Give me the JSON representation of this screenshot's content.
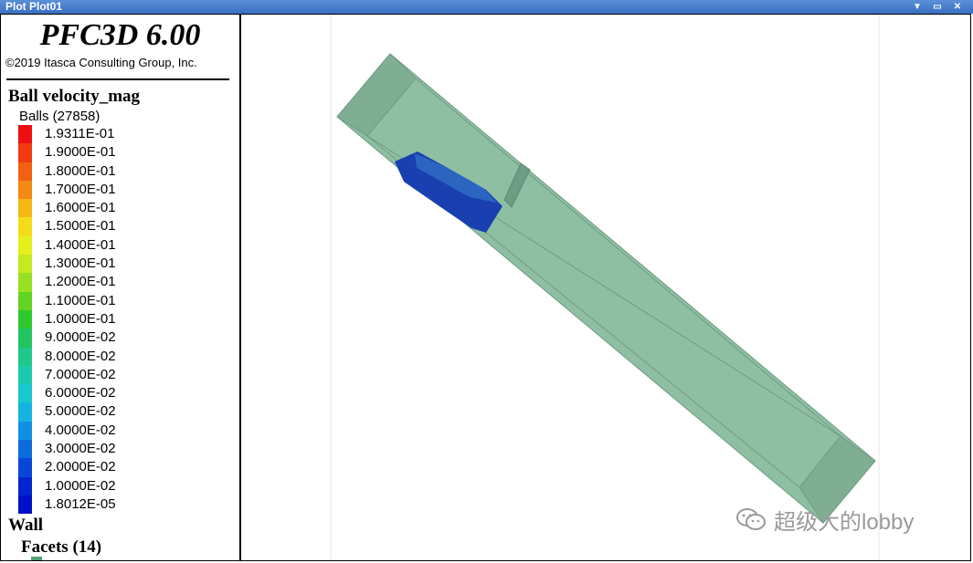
{
  "window": {
    "title": "Plot Plot01",
    "controls": {
      "dropdown": "▼",
      "restore": "▭",
      "close": "✕"
    }
  },
  "legend": {
    "brand": "PFC3D 6.00",
    "copyright": "©2019 Itasca Consulting Group, Inc.",
    "ball_section": {
      "title": "Ball velocity_mag",
      "subtitle": "Balls (27858)",
      "entries": [
        {
          "value": "1.9311E-01",
          "color": "#ee1010"
        },
        {
          "value": "1.9000E-01",
          "color": "#f03a10"
        },
        {
          "value": "1.8000E-01",
          "color": "#f26012"
        },
        {
          "value": "1.7000E-01",
          "color": "#f28a12"
        },
        {
          "value": "1.6000E-01",
          "color": "#f5b814"
        },
        {
          "value": "1.5000E-01",
          "color": "#f5dc18"
        },
        {
          "value": "1.4000E-01",
          "color": "#e4f01c"
        },
        {
          "value": "1.3000E-01",
          "color": "#c4ea20"
        },
        {
          "value": "1.2000E-01",
          "color": "#98e022"
        },
        {
          "value": "1.1000E-01",
          "color": "#62d424"
        },
        {
          "value": "1.0000E-01",
          "color": "#2ec82e"
        },
        {
          "value": "9.0000E-02",
          "color": "#22c460"
        },
        {
          "value": "8.0000E-02",
          "color": "#20c88c"
        },
        {
          "value": "7.0000E-02",
          "color": "#1ccab0"
        },
        {
          "value": "6.0000E-02",
          "color": "#18c8cc"
        },
        {
          "value": "5.0000E-02",
          "color": "#14b4e0"
        },
        {
          "value": "4.0000E-02",
          "color": "#1090e0"
        },
        {
          "value": "3.0000E-02",
          "color": "#0c6cdc"
        },
        {
          "value": "2.0000E-02",
          "color": "#0846d8"
        },
        {
          "value": "1.0000E-02",
          "color": "#0424d0"
        },
        {
          "value": "1.8012E-05",
          "color": "#0010c8"
        }
      ]
    },
    "wall_section": {
      "title": "Wall",
      "facets_label": "Facets (14)",
      "facet_color": "#4fa37a"
    }
  },
  "viewport": {
    "model_color": "#8fbfa3",
    "particle_color": "#1a3fb0"
  },
  "watermark": {
    "text": "超级大的lobby"
  }
}
